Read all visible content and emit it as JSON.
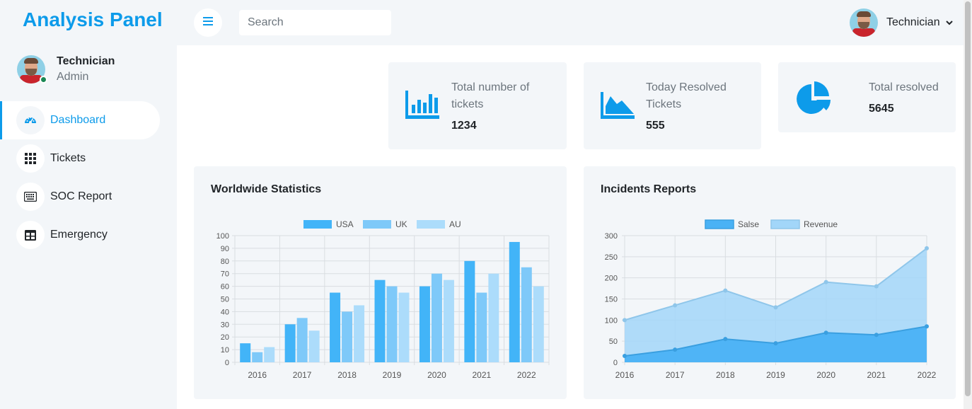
{
  "brand": "Analysis Panel",
  "profile": {
    "name": "Technician",
    "role": "Admin"
  },
  "sidebar": {
    "items": [
      {
        "label": "Dashboard",
        "icon": "speedometer-icon",
        "active": true
      },
      {
        "label": "Tickets",
        "icon": "grid-icon",
        "active": false
      },
      {
        "label": "SOC Report",
        "icon": "keyboard-icon",
        "active": false
      },
      {
        "label": "Emergency",
        "icon": "table-icon",
        "active": false
      }
    ]
  },
  "header": {
    "search_placeholder": "Search",
    "user_name": "Technician"
  },
  "stats": [
    {
      "label": "Total number of tickets",
      "value": "1234",
      "icon": "bar-chart-icon"
    },
    {
      "label": "Today Resolved Tickets",
      "value": "555",
      "icon": "area-chart-icon"
    },
    {
      "label": "Total resolved",
      "value": "5645",
      "icon": "pie-chart-icon"
    }
  ],
  "colors": {
    "accent": "#0d9bea",
    "usa": "#42b4f8",
    "uk": "#7ec9f9",
    "au": "#acdcfb",
    "sales": "#4ab2f5",
    "revenue": "#a2d6f9"
  },
  "chart_data": [
    {
      "type": "bar",
      "title": "Worldwide Statistics",
      "categories": [
        "2016",
        "2017",
        "2018",
        "2019",
        "2020",
        "2021",
        "2022"
      ],
      "series": [
        {
          "name": "USA",
          "values": [
            15,
            30,
            55,
            65,
            60,
            80,
            95
          ]
        },
        {
          "name": "UK",
          "values": [
            8,
            35,
            40,
            60,
            70,
            55,
            75
          ]
        },
        {
          "name": "AU",
          "values": [
            12,
            25,
            45,
            55,
            65,
            70,
            60
          ]
        }
      ],
      "ylim": [
        0,
        100
      ],
      "yticks": [
        0,
        10,
        20,
        30,
        40,
        50,
        60,
        70,
        80,
        90,
        100
      ],
      "grid": true,
      "legend": "top-center"
    },
    {
      "type": "area",
      "title": "Incidents Reports",
      "categories": [
        "2016",
        "2017",
        "2018",
        "2019",
        "2020",
        "2021",
        "2022"
      ],
      "series": [
        {
          "name": "Salse",
          "values": [
            15,
            30,
            55,
            45,
            70,
            65,
            85
          ]
        },
        {
          "name": "Revenue",
          "values": [
            100,
            135,
            170,
            130,
            190,
            180,
            270
          ]
        }
      ],
      "ylim": [
        0,
        300
      ],
      "yticks": [
        0,
        50,
        100,
        150,
        200,
        250,
        300
      ],
      "grid": true,
      "legend": "top-center"
    }
  ]
}
